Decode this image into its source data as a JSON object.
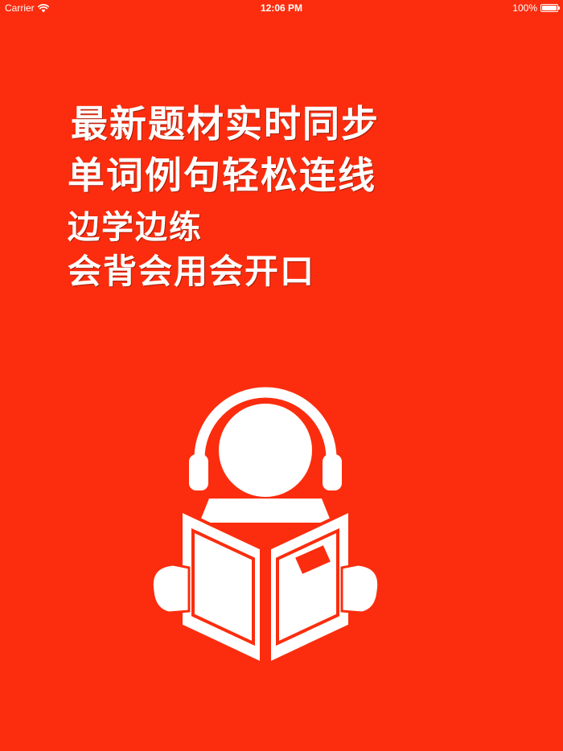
{
  "status_bar": {
    "carrier": "Carrier",
    "time": "12:06 PM",
    "battery_percent": "100%",
    "battery_level": 1.0
  },
  "splash": {
    "lines": [
      "最新题材实时同步",
      "单词例句轻松连线",
      "边学边练",
      "会背会用会开口"
    ],
    "background_color": "#fb2d0e",
    "text_color": "#ffffff",
    "logo_icon": "reader-with-headphones-icon"
  }
}
